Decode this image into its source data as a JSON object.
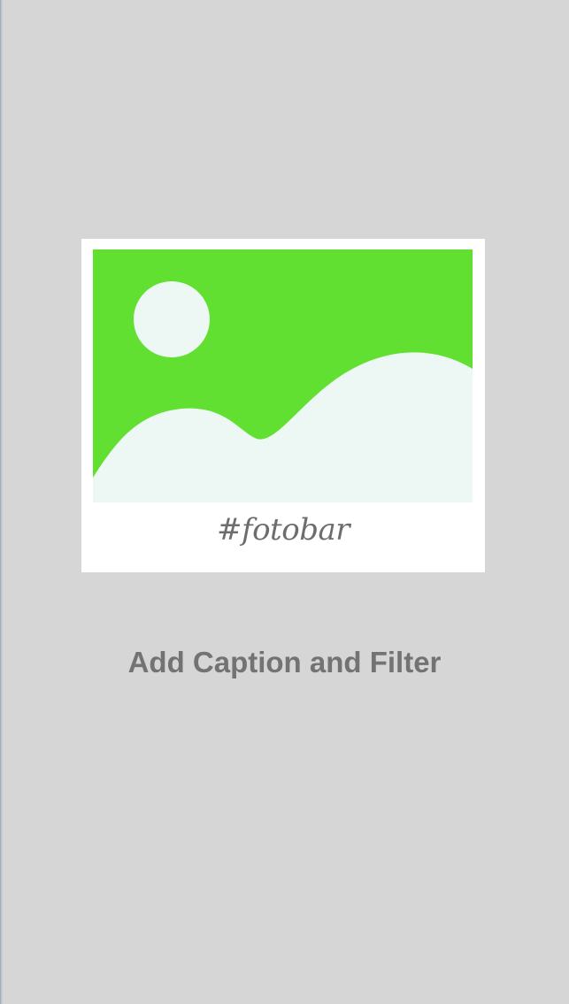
{
  "preview_card": {
    "image_icon": "landscape-photo-icon",
    "caption_text": "#fotobar"
  },
  "action": {
    "label": "Add Caption and Filter"
  },
  "colors": {
    "background": "#d6d6d6",
    "card": "#ffffff",
    "photo_sky": "#62e031",
    "photo_land": "#edf8f4",
    "caption_text": "#6d6d6d",
    "action_text": "#737373"
  }
}
